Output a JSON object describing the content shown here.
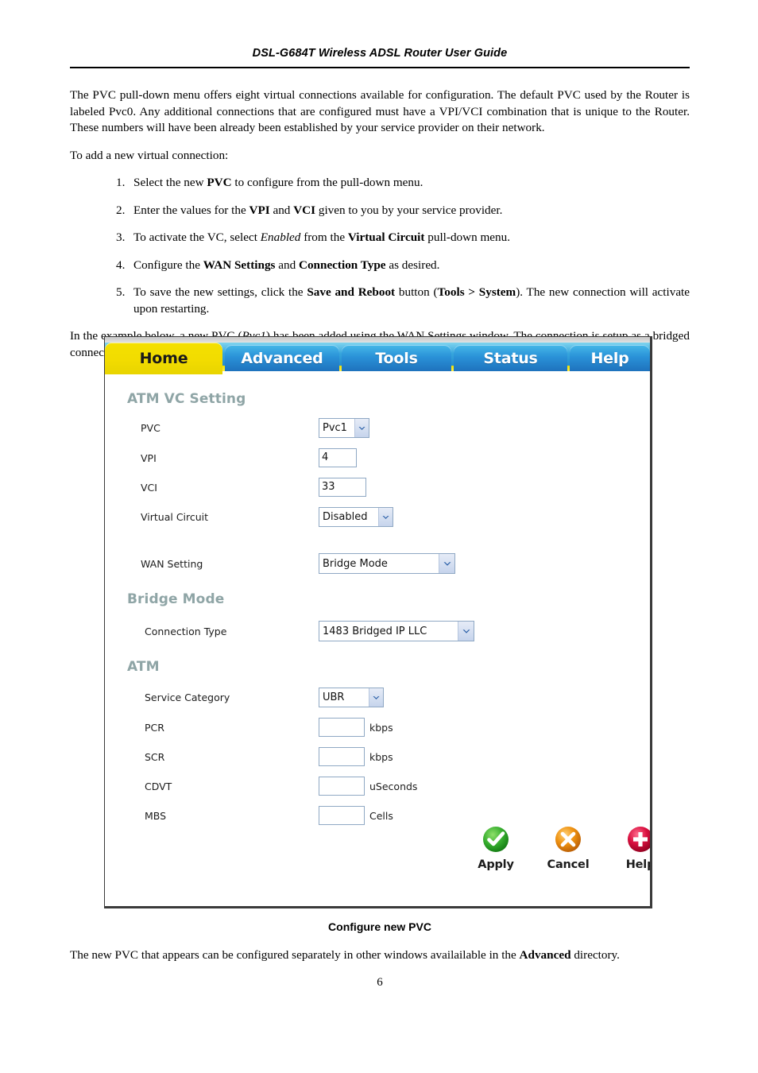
{
  "document": {
    "header_title": "DSL-G684T Wireless ADSL Router User Guide",
    "page_number": "6",
    "intro_paragraph_1": "The PVC pull-down menu offers eight virtual connections available for configuration. The default PVC used by the Router is labeled Pvc0. Any additional connections that are configured must have a VPI/VCI combination that is unique to the Router. These numbers will have been already been established by your service provider on their network.",
    "intro_paragraph_2": "To add a new virtual connection:",
    "steps": [
      {
        "parts": [
          {
            "t": "Select the new ",
            "s": "n"
          },
          {
            "t": "PVC",
            "s": "b"
          },
          {
            "t": " to configure from the pull-down menu.",
            "s": "n"
          }
        ]
      },
      {
        "parts": [
          {
            "t": "Enter the values for the ",
            "s": "n"
          },
          {
            "t": "VPI",
            "s": "b"
          },
          {
            "t": " and ",
            "s": "n"
          },
          {
            "t": "VCI",
            "s": "b"
          },
          {
            "t": " given to you by your service provider.",
            "s": "n"
          }
        ]
      },
      {
        "parts": [
          {
            "t": "To activate the VC, select ",
            "s": "n"
          },
          {
            "t": "Enabled",
            "s": "i"
          },
          {
            "t": " from the ",
            "s": "n"
          },
          {
            "t": "Virtual Circuit",
            "s": "b"
          },
          {
            "t": " pull-down menu.",
            "s": "n"
          }
        ]
      },
      {
        "parts": [
          {
            "t": "Configure the ",
            "s": "n"
          },
          {
            "t": "WAN Settings",
            "s": "b"
          },
          {
            "t": " and ",
            "s": "n"
          },
          {
            "t": "Connection Type",
            "s": "b"
          },
          {
            "t": " as desired.",
            "s": "n"
          }
        ]
      },
      {
        "parts": [
          {
            "t": "To save the new settings, click the ",
            "s": "n"
          },
          {
            "t": "Save and Reboot",
            "s": "b"
          },
          {
            "t": " button (",
            "s": "n"
          },
          {
            "t": "Tools > System",
            "s": "b"
          },
          {
            "t": "). The new connection will activate upon restarting.",
            "s": "n"
          }
        ]
      }
    ],
    "example_paragraph": {
      "parts": [
        {
          "t": "In the example below, a new PVC (",
          "s": "n"
        },
        {
          "t": "Pvc1",
          "s": "i"
        },
        {
          "t": ") has been added using the WAN Settings window. The connection is setup as a bridged connection.",
          "s": "n"
        }
      ]
    },
    "figure_caption": "Configure new PVC",
    "closing_paragraph": {
      "parts": [
        {
          "t": "The new PVC that appears can be configured separately in other windows availailable in the ",
          "s": "n"
        },
        {
          "t": "Advanced",
          "s": "b"
        },
        {
          "t": " directory.",
          "s": "n"
        }
      ]
    }
  },
  "router_ui": {
    "nav_tabs": [
      {
        "label": "Home",
        "active": true
      },
      {
        "label": "Advanced",
        "active": false
      },
      {
        "label": "Tools",
        "active": false
      },
      {
        "label": "Status",
        "active": false
      },
      {
        "label": "Help",
        "active": false
      }
    ],
    "sections": {
      "atm_vc_setting": {
        "title": "ATM VC Setting",
        "fields": {
          "pvc": {
            "label": "PVC",
            "value": "Pvc1",
            "control": "select"
          },
          "vpi": {
            "label": "VPI",
            "value": "4",
            "control": "text"
          },
          "vci": {
            "label": "VCI",
            "value": "33",
            "control": "text"
          },
          "virtual_circuit": {
            "label": "Virtual Circuit",
            "value": "Disabled",
            "control": "select"
          },
          "wan_setting": {
            "label": "WAN Setting",
            "value": "Bridge Mode",
            "control": "select"
          }
        }
      },
      "bridge_mode": {
        "title": "Bridge Mode",
        "fields": {
          "connection_type": {
            "label": "Connection Type",
            "value": "1483 Bridged IP LLC",
            "control": "select"
          }
        }
      },
      "atm": {
        "title": "ATM",
        "fields": {
          "service_category": {
            "label": "Service Category",
            "value": "UBR",
            "control": "select"
          },
          "pcr": {
            "label": "PCR",
            "value": "",
            "unit": "kbps",
            "control": "text"
          },
          "scr": {
            "label": "SCR",
            "value": "",
            "unit": "kbps",
            "control": "text"
          },
          "cdvt": {
            "label": "CDVT",
            "value": "",
            "unit": "uSeconds",
            "control": "text"
          },
          "mbs": {
            "label": "MBS",
            "value": "",
            "unit": "Cells",
            "control": "text"
          }
        }
      }
    },
    "actions": [
      {
        "label": "Apply",
        "icon": "check-circle-icon",
        "color": "#2fa12f"
      },
      {
        "label": "Cancel",
        "icon": "x-circle-icon",
        "color": "#e08a14"
      },
      {
        "label": "Help",
        "icon": "plus-circle-icon",
        "color": "#d4073c"
      }
    ],
    "colors": {
      "active_tab": "#f2dc00",
      "tab_blue": "#2a92d8",
      "section_heading": "#8fa5a6",
      "input_border": "#8fa8c4"
    }
  }
}
